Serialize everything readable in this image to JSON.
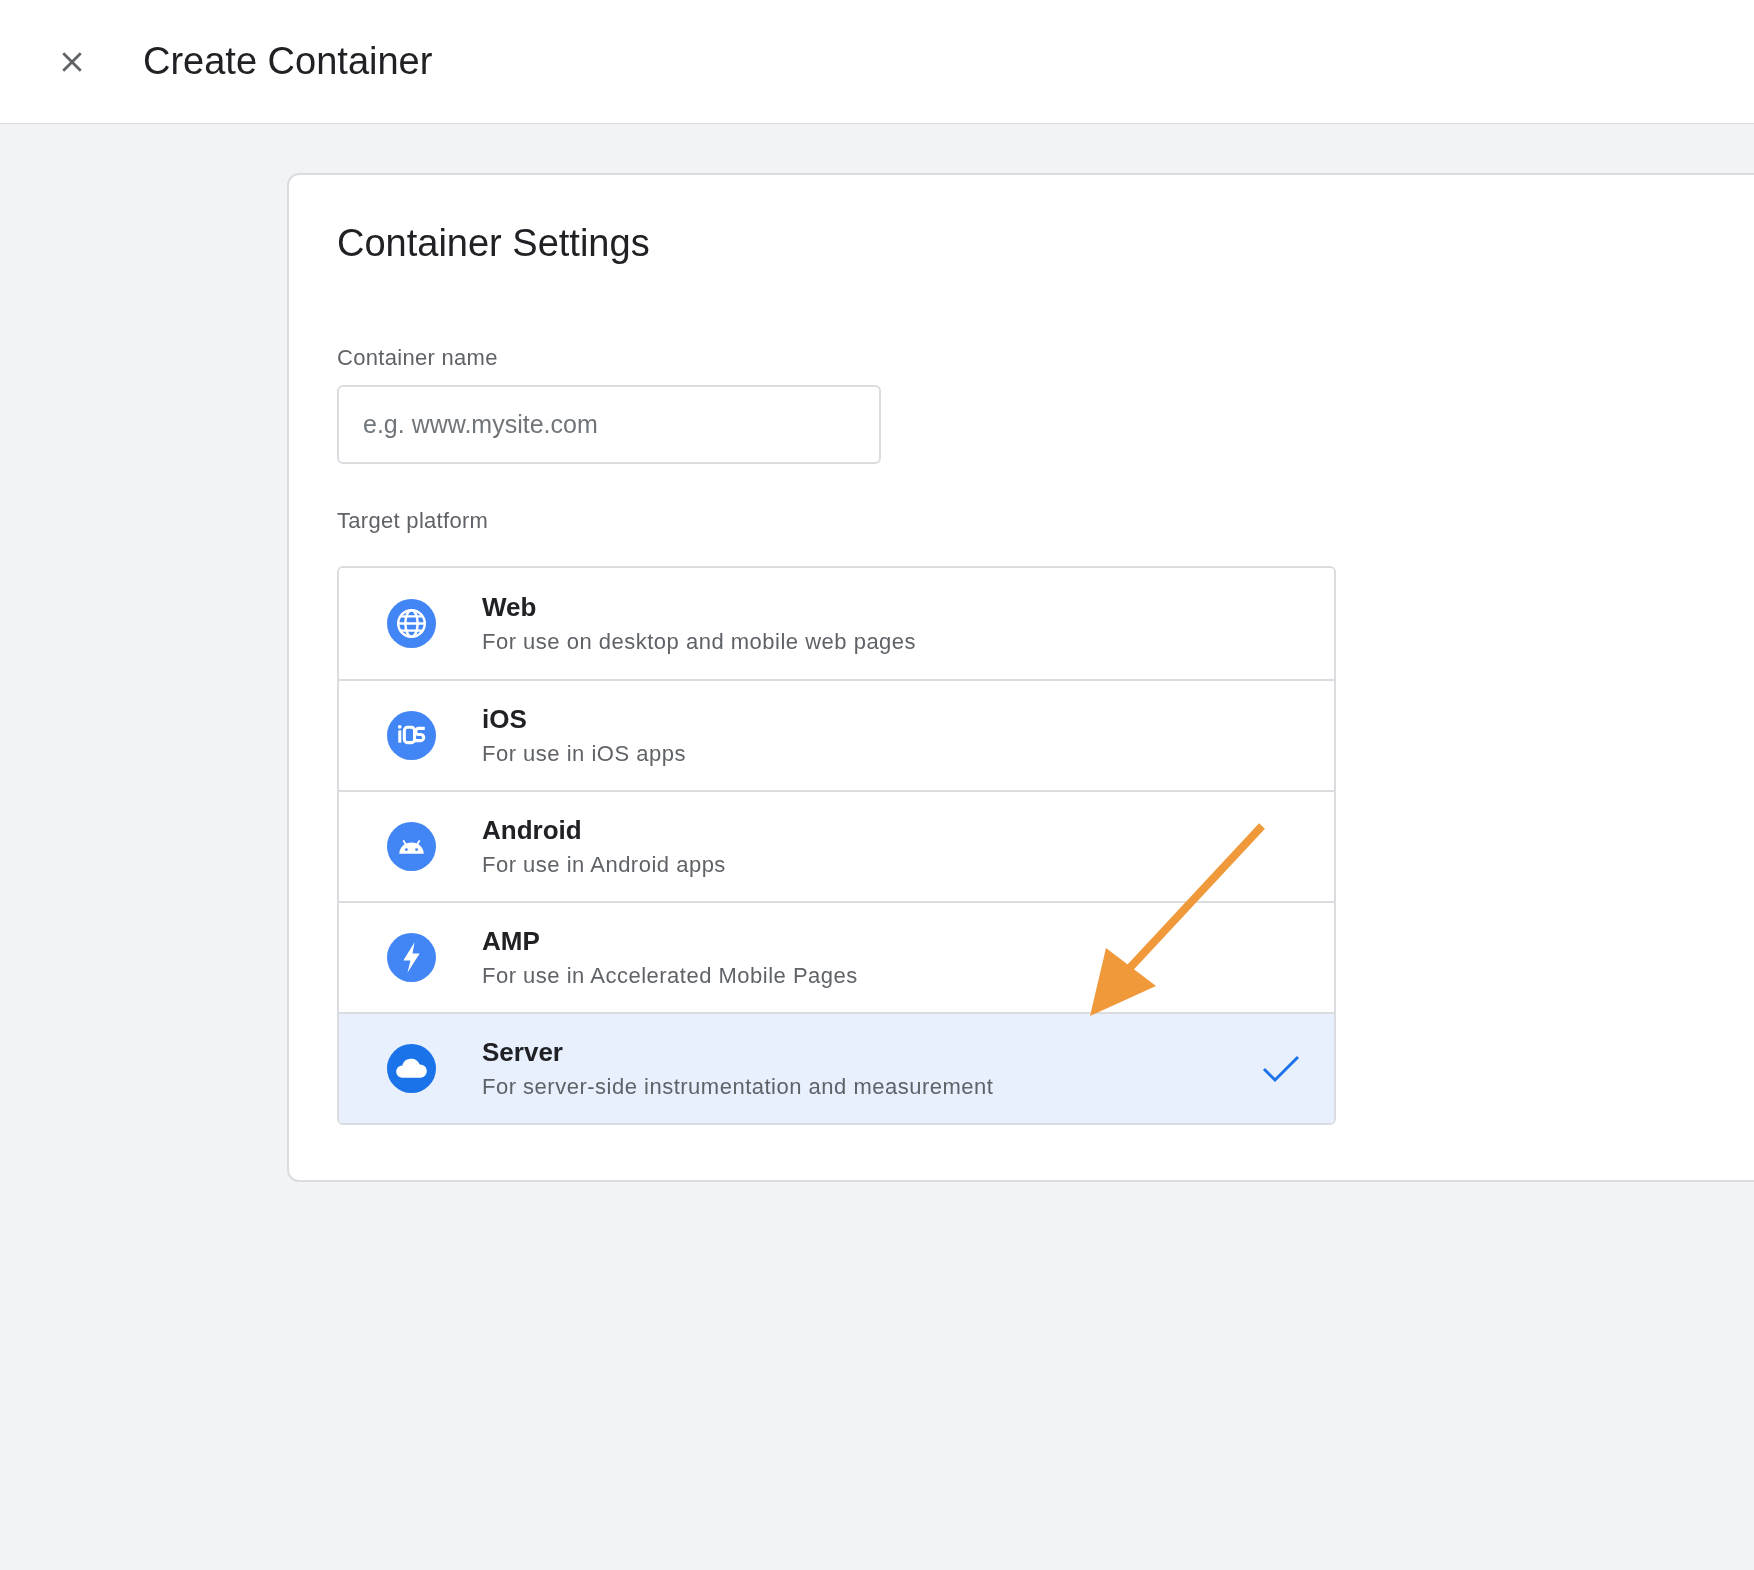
{
  "header": {
    "title": "Create Container"
  },
  "settings": {
    "heading": "Container Settings",
    "name_label": "Container name",
    "name_field": {
      "placeholder": "e.g. www.mysite.com"
    },
    "platform_label": "Target platform",
    "platforms": [
      {
        "kind": "web",
        "title": "Web",
        "description": "For use on desktop and mobile web pages",
        "selected": false
      },
      {
        "kind": "ios",
        "title": "iOS",
        "description": "For use in iOS apps",
        "selected": false
      },
      {
        "kind": "android",
        "title": "Android",
        "description": "For use in Android apps",
        "selected": false
      },
      {
        "kind": "amp",
        "title": "AMP",
        "description": "For use in Accelerated Mobile Pages",
        "selected": false
      },
      {
        "kind": "server",
        "title": "Server",
        "description": "For server-side instrumentation and measurement",
        "selected": true
      }
    ]
  }
}
